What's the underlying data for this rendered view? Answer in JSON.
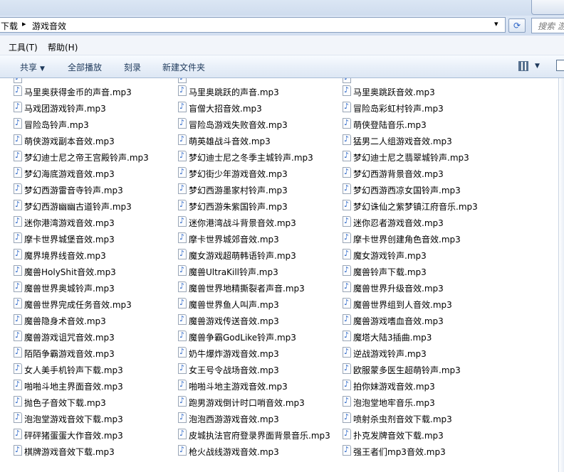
{
  "address": {
    "segments": [
      "下载",
      "游戏音效"
    ],
    "separator": "▸",
    "dropdown_glyph": "▾",
    "refresh_glyph": "⟳"
  },
  "search": {
    "placeholder": "搜索 游"
  },
  "menu": {
    "items": [
      "工具(T)",
      "帮助(H)"
    ]
  },
  "toolbar": {
    "share_label": "共享",
    "dropdown_glyph": "▼",
    "play_all_label": "全部播放",
    "burn_label": "刻录",
    "new_folder_label": "新建文件夹"
  },
  "icons": {
    "file_icon": "audio-file-icon",
    "view_icon": "view-options-icon",
    "preview_icon": "preview-pane-icon"
  },
  "files": {
    "col1": [
      "马里奥获得金币的声音.mp3",
      "马戏团游戏铃声.mp3",
      "冒险岛铃声.mp3",
      "萌侠游戏副本音效.mp3",
      "梦幻迪士尼之帝王宫殿铃声.mp3",
      "梦幻海底游戏音效.mp3",
      "梦幻西游雷音寺铃声.mp3",
      "梦幻西游幽幽古道铃声.mp3",
      "迷你港湾游戏音效.mp3",
      "摩卡世界城堡音效.mp3",
      "魔界境界线音效.mp3",
      "魔兽HolyShit音效.mp3",
      "魔兽世界奥城铃声.mp3",
      "魔兽世界完成任务音效.mp3",
      "魔兽隐身术音效.mp3",
      "魔兽游戏诅咒音效.mp3",
      "陌陌争霸游戏音效.mp3",
      "女人美手机铃声下载.mp3",
      "啪啪斗地主界面音效.mp3",
      "抛色子音效下载.mp3",
      "泡泡堂游戏音效下载.mp3",
      "砰砰猪蛋蛋大作音效.mp3",
      "棋牌游戏音效下载.mp3"
    ],
    "col2": [
      "马里奥跳跃的声音.mp3",
      "盲僧大招音效.mp3",
      "冒险岛游戏失败音效.mp3",
      "萌英雄战斗音效.mp3",
      "梦幻迪士尼之冬季主城铃声.mp3",
      "梦幻街少年游戏音效.mp3",
      "梦幻西游墨家村铃声.mp3",
      "梦幻西游朱紫国铃声.mp3",
      "迷你港湾战斗背景音效.mp3",
      "摩卡世界城郊音效.mp3",
      "魔女游戏超萌韩语铃声.mp3",
      "魔兽UltraKill铃声.mp3",
      "魔兽世界地精撕裂者声音.mp3",
      "魔兽世界鱼人叫声.mp3",
      "魔兽游戏传送音效.mp3",
      "魔兽争霸GodLike铃声.mp3",
      "奶牛爆炸游戏音效.mp3",
      "女王号令战场音效.mp3",
      "啪啪斗地主游戏音效.mp3",
      "跑男游戏倒计时口哨音效.mp3",
      "泡泡西游游戏音效.mp3",
      "皮城执法官府登录界面背景音乐.mp3",
      "枪火战线游戏音效.mp3"
    ],
    "col3": [
      "马里奥跳跃音效.mp3",
      "冒险岛彩虹村铃声.mp3",
      "萌侠登陆音乐.mp3",
      "猛男二人组游戏音效.mp3",
      "梦幻迪士尼之翡翠城铃声.mp3",
      "梦幻西游背景音效.mp3",
      "梦幻西游西凉女国铃声.mp3",
      "梦幻诛仙之紫梦镇江府音乐.mp3",
      "迷你忍者游戏音效.mp3",
      "摩卡世界创建角色音效.mp3",
      "魔女游戏铃声.mp3",
      "魔兽铃声下载.mp3",
      "魔兽世界升级音效.mp3",
      "魔兽世界组到人音效.mp3",
      "魔兽游戏嗜血音效.mp3",
      "魔塔大陆3插曲.mp3",
      "逆战游戏铃声.mp3",
      "欧服蒙多医生超萌铃声.mp3",
      "拍你妹游戏音效.mp3",
      "泡泡堂地牢音乐.mp3",
      "喷射杀虫剂音效下载.mp3",
      "扑克发牌音效下载.mp3",
      "强王者们mp3音效.mp3"
    ]
  }
}
